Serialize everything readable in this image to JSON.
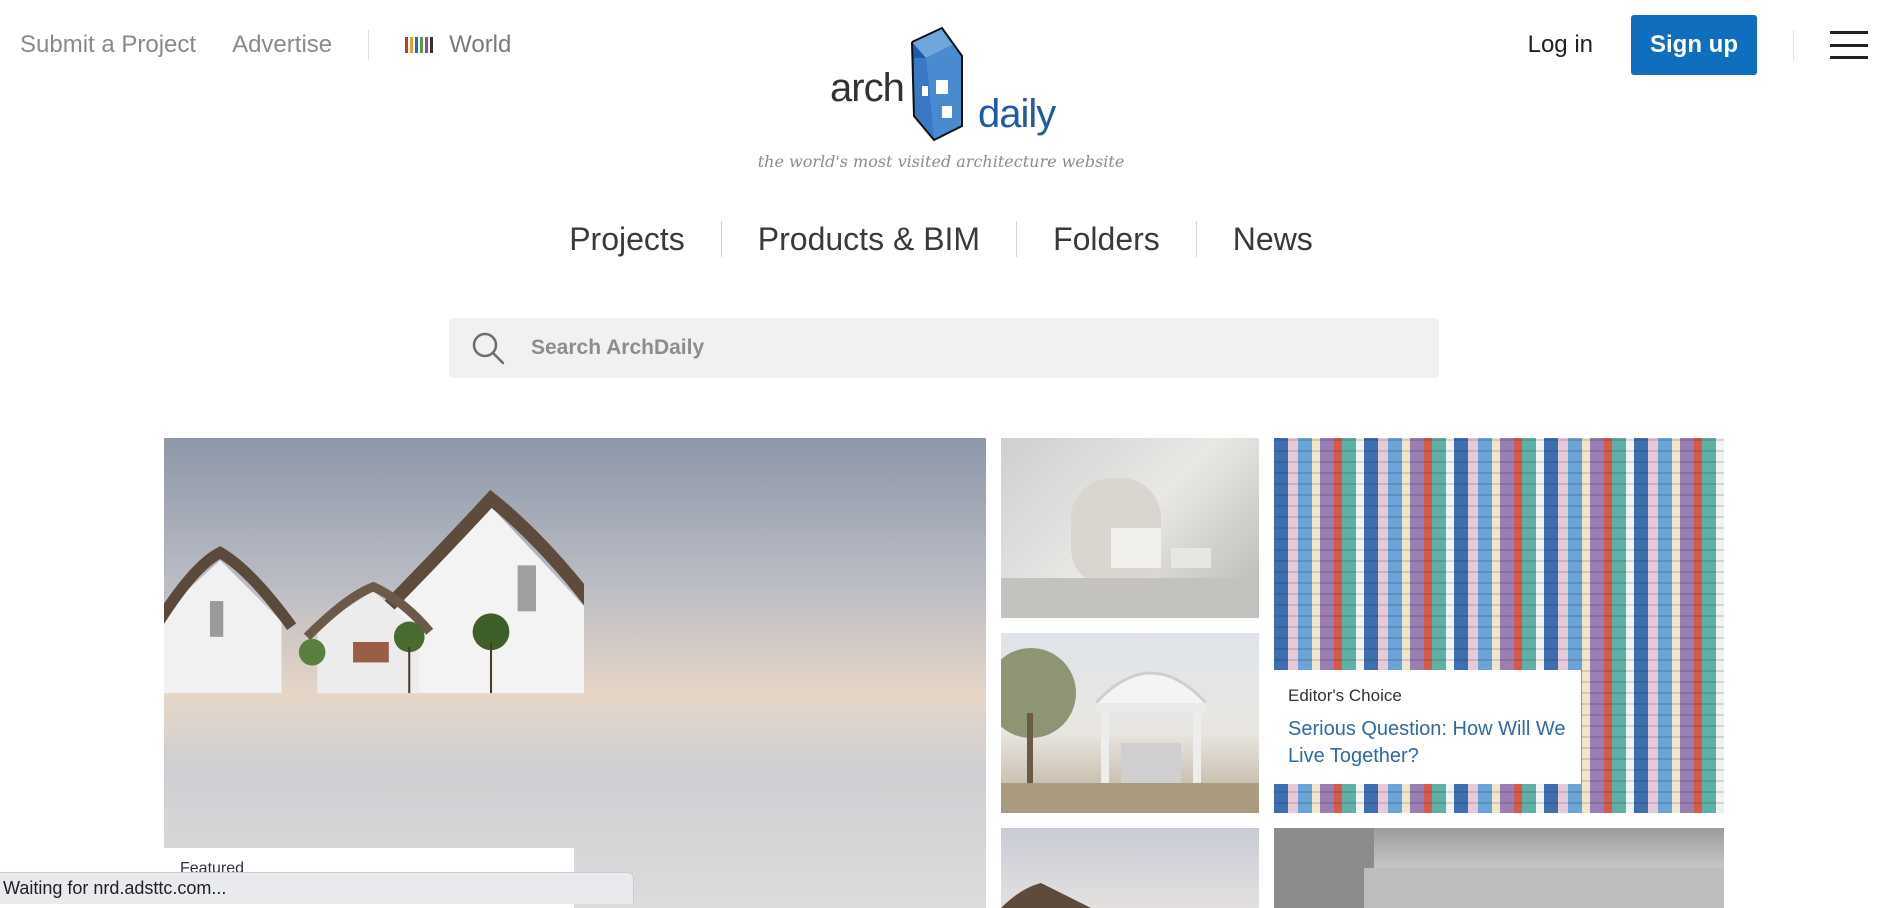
{
  "header": {
    "left_links": [
      {
        "label": "Submit a Project"
      },
      {
        "label": "Advertise"
      }
    ],
    "world": {
      "label": "World",
      "icon": "flag-stripes-icon"
    },
    "logo": {
      "word1": "arch",
      "word2": "daily"
    },
    "tagline": "the world's most visited architecture website",
    "login_label": "Log in",
    "signup_label": "Sign up",
    "menu_icon": "hamburger-icon"
  },
  "nav": {
    "items": [
      {
        "label": "Projects"
      },
      {
        "label": "Products & BIM"
      },
      {
        "label": "Folders"
      },
      {
        "label": "News"
      }
    ]
  },
  "search": {
    "placeholder": "Search ArchDaily",
    "value": "",
    "icon": "search-icon"
  },
  "featured": {
    "hero": {
      "label": "Featured"
    },
    "editors_choice": {
      "label": "Editor's Choice",
      "title": "Serious Question: How Will We Live Together?"
    }
  },
  "status_bar": {
    "text": "Waiting for nrd.adsttc.com..."
  },
  "colors": {
    "brand_blue": "#0f6ebd",
    "link_blue": "#2e6aa6",
    "search_bg": "#f1f1f1"
  }
}
